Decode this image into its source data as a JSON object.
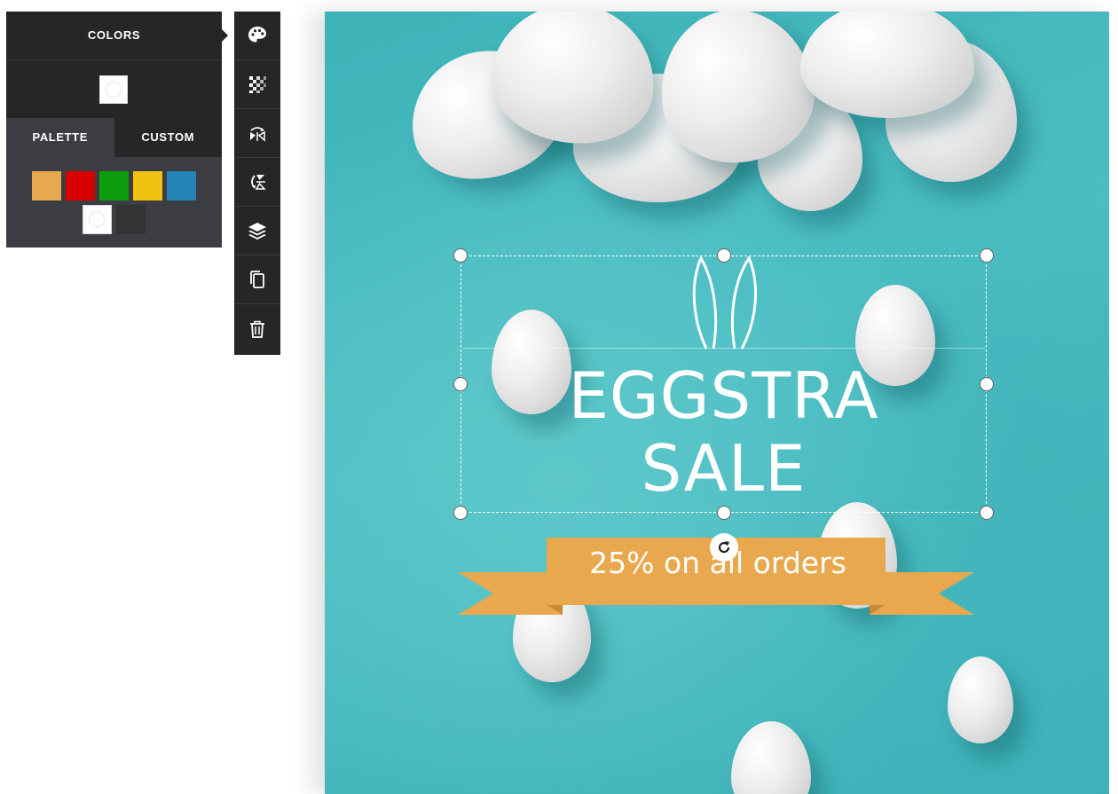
{
  "colors_panel": {
    "title": "COLORS",
    "current_color": "#ffffff",
    "tabs": [
      {
        "label": "PALETTE",
        "active": true
      },
      {
        "label": "CUSTOM",
        "active": false
      }
    ],
    "palette": [
      "#eaa84e",
      "#d90000",
      "#0c9d0c",
      "#f0c313",
      "#2384b5",
      "#ffffff",
      "#333333"
    ]
  },
  "toolbar": {
    "tools": [
      "palette-icon",
      "transparency-icon",
      "flip-horizontal-icon",
      "flip-vertical-icon",
      "layers-icon",
      "duplicate-icon",
      "delete-icon"
    ]
  },
  "canvas": {
    "background_color": "#45b9bd",
    "headline": {
      "line1": "EGGSTRA",
      "line2": "SALE"
    },
    "banner": {
      "text": "25% on all orders",
      "color": "#eaa84e"
    }
  }
}
